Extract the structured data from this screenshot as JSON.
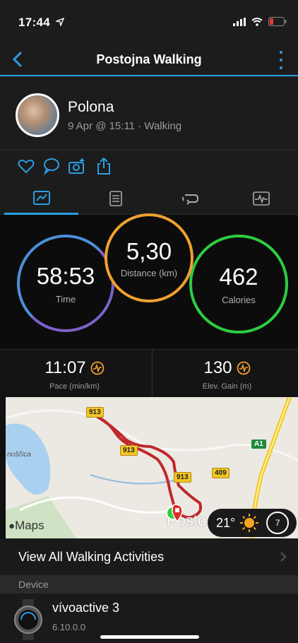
{
  "status": {
    "time": "17:44"
  },
  "nav": {
    "title": "Postojna Walking"
  },
  "header": {
    "name": "Polona",
    "subtitle": "9 Apr @ 15:11 · Walking"
  },
  "stats": {
    "time": {
      "value": "58:53",
      "label": "Time"
    },
    "distance": {
      "value": "5,30",
      "label": "Distance (km)"
    },
    "calories": {
      "value": "462",
      "label": "Calories"
    }
  },
  "metrics": [
    {
      "value": "11:07",
      "label": "Pace (min/km)"
    },
    {
      "value": "130",
      "label": "Elev. Gain (m)"
    }
  ],
  "map": {
    "road_913_a": "913",
    "road_913_b": "913",
    "road_913_c": "913",
    "road_409": "409",
    "road_a1": "A1",
    "town_left": "noščica",
    "town_bottom": "Posto",
    "attribution": "Maps",
    "weather_temp": "21°",
    "wind": "7"
  },
  "view_all": {
    "label": "View All Walking Activities"
  },
  "section": {
    "label": "Device"
  },
  "device": {
    "name": "vívoactive 3",
    "version": "6.10.0.0"
  },
  "colors": {
    "accent": "#2a9fe0",
    "time_ring": "#4a90d9",
    "distance_ring": "#f0a030",
    "calories_ring": "#2ecc40",
    "route": "#c0282c"
  }
}
